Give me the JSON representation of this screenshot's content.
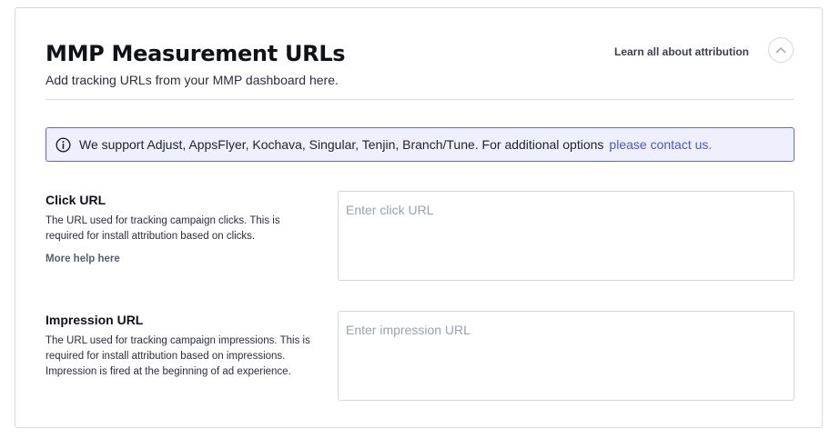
{
  "header": {
    "title": "MMP Measurement URLs",
    "subtitle": "Add tracking URLs from your MMP dashboard here.",
    "learn_link": "Learn all about attribution",
    "collapse_icon": "chevron-up-icon"
  },
  "info_banner": {
    "icon": "info-icon",
    "text": "We support Adjust, AppsFlyer, Kochava, Singular, Tenjin, Branch/Tune. For additional options",
    "link": "please contact us.",
    "accent_color": "#5b6ae0"
  },
  "fields": {
    "click": {
      "label": "Click URL",
      "description": "The URL used for tracking campaign clicks. This is required for install attribution based on clicks.",
      "help_link": "More help here",
      "placeholder": "Enter click URL",
      "value": ""
    },
    "impression": {
      "label": "Impression URL",
      "description": "The URL used for tracking campaign impressions. This is required for install attribution based on impressions. Impression is fired at the beginning of ad experience.",
      "placeholder": "Enter impression URL",
      "value": ""
    }
  }
}
